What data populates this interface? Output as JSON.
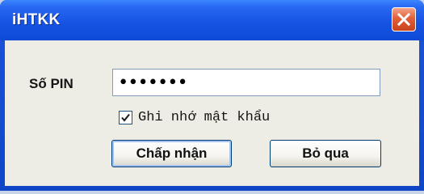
{
  "window": {
    "title": "iHTKK",
    "close_icon": "close-icon"
  },
  "form": {
    "pin_label": "Số PIN",
    "pin_value": "•••••••",
    "remember_checked": true,
    "remember_label": "Ghi nhớ mật khẩu"
  },
  "buttons": {
    "ok_label": "Chấp nhận",
    "cancel_label": "Bỏ qua"
  },
  "colors": {
    "titlebar": "#1754e4",
    "close_button": "#e2603a",
    "client_background": "#eeede5"
  }
}
